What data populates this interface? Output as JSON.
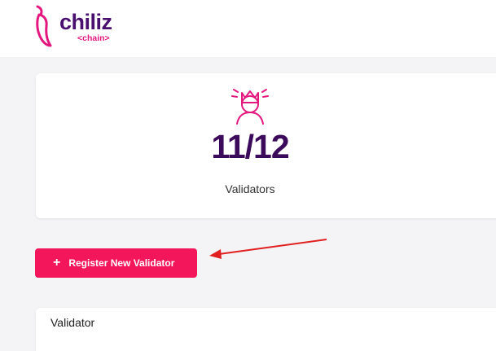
{
  "header": {
    "logo_word": "chiliz",
    "logo_sub": "<chain>",
    "logo_icon": "chili-pepper-icon"
  },
  "stats": {
    "icon": "validator-crown-icon",
    "count": "11/12",
    "label": "Validators"
  },
  "actions": {
    "register_label": "Register New Validator",
    "register_icon": "plus-icon"
  },
  "table": {
    "header": "Validator"
  },
  "colors": {
    "brand_pink": "#e4177f",
    "brand_purple": "#3c0a5a",
    "button": "#f4165a",
    "arrow": "#e02020"
  }
}
